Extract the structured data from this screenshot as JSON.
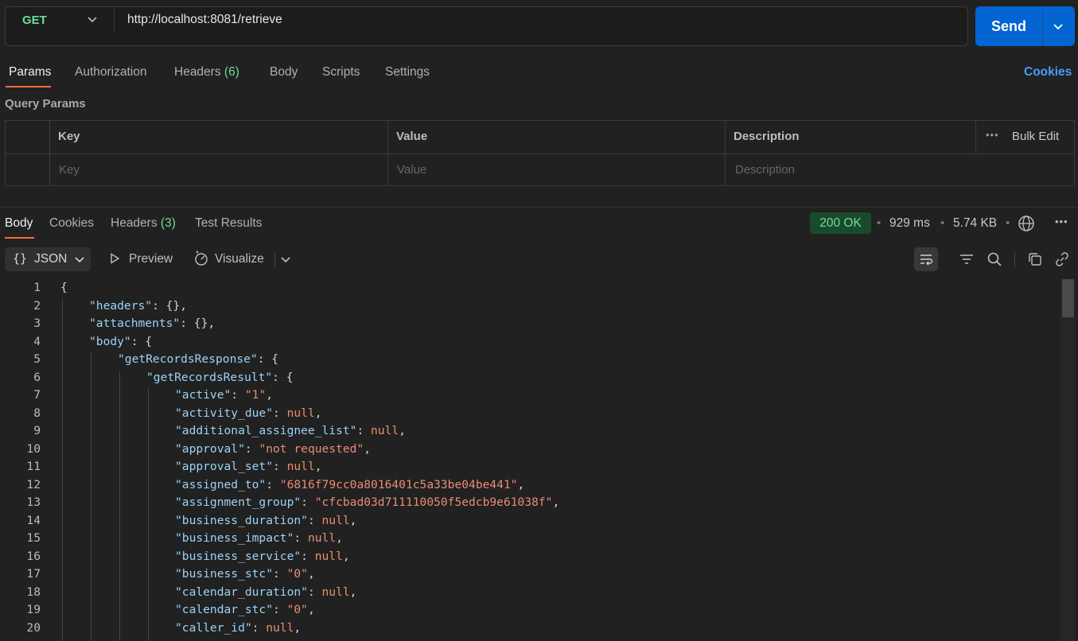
{
  "request": {
    "method": "GET",
    "url": "http://localhost:8081/retrieve",
    "send_label": "Send"
  },
  "request_tabs": {
    "params": "Params",
    "authorization": "Authorization",
    "headers": "Headers",
    "headers_count": "(6)",
    "body": "Body",
    "scripts": "Scripts",
    "settings": "Settings",
    "cookies": "Cookies"
  },
  "query_params": {
    "title": "Query Params",
    "columns": {
      "key": "Key",
      "value": "Value",
      "description": "Description",
      "bulk_edit": "Bulk Edit"
    },
    "placeholders": {
      "key": "Key",
      "value": "Value",
      "description": "Description"
    }
  },
  "response_tabs": {
    "body": "Body",
    "cookies": "Cookies",
    "headers": "Headers",
    "headers_count": "(3)",
    "test_results": "Test Results"
  },
  "response_meta": {
    "status": "200 OK",
    "time": "929 ms",
    "size": "5.74 KB",
    "status_color": "#6bdd9a"
  },
  "body_toolbar": {
    "format": "JSON",
    "preview": "Preview",
    "visualize": "Visualize"
  },
  "code_lines": [
    {
      "n": "1",
      "indent": 0,
      "tokens": [
        [
          "p",
          "{"
        ]
      ]
    },
    {
      "n": "2",
      "indent": 1,
      "tokens": [
        [
          "k",
          "\"headers\""
        ],
        [
          "p",
          ": {},"
        ]
      ]
    },
    {
      "n": "3",
      "indent": 1,
      "tokens": [
        [
          "k",
          "\"attachments\""
        ],
        [
          "p",
          ": {},"
        ]
      ]
    },
    {
      "n": "4",
      "indent": 1,
      "tokens": [
        [
          "k",
          "\"body\""
        ],
        [
          "p",
          ": {"
        ]
      ]
    },
    {
      "n": "5",
      "indent": 2,
      "tokens": [
        [
          "k",
          "\"getRecordsResponse\""
        ],
        [
          "p",
          ": {"
        ]
      ]
    },
    {
      "n": "6",
      "indent": 3,
      "tokens": [
        [
          "k",
          "\"getRecordsResult\""
        ],
        [
          "p",
          ": {"
        ]
      ]
    },
    {
      "n": "7",
      "indent": 4,
      "tokens": [
        [
          "k",
          "\"active\""
        ],
        [
          "p",
          ": "
        ],
        [
          "s",
          "\"1\""
        ],
        [
          "p",
          ","
        ]
      ]
    },
    {
      "n": "8",
      "indent": 4,
      "tokens": [
        [
          "k",
          "\"activity_due\""
        ],
        [
          "p",
          ": "
        ],
        [
          "n",
          "null"
        ],
        [
          "p",
          ","
        ]
      ]
    },
    {
      "n": "9",
      "indent": 4,
      "tokens": [
        [
          "k",
          "\"additional_assignee_list\""
        ],
        [
          "p",
          ": "
        ],
        [
          "n",
          "null"
        ],
        [
          "p",
          ","
        ]
      ]
    },
    {
      "n": "10",
      "indent": 4,
      "tokens": [
        [
          "k",
          "\"approval\""
        ],
        [
          "p",
          ": "
        ],
        [
          "s",
          "\"not requested\""
        ],
        [
          "p",
          ","
        ]
      ]
    },
    {
      "n": "11",
      "indent": 4,
      "tokens": [
        [
          "k",
          "\"approval_set\""
        ],
        [
          "p",
          ": "
        ],
        [
          "n",
          "null"
        ],
        [
          "p",
          ","
        ]
      ]
    },
    {
      "n": "12",
      "indent": 4,
      "tokens": [
        [
          "k",
          "\"assigned_to\""
        ],
        [
          "p",
          ": "
        ],
        [
          "s",
          "\"6816f79cc0a8016401c5a33be04be441\""
        ],
        [
          "p",
          ","
        ]
      ]
    },
    {
      "n": "13",
      "indent": 4,
      "tokens": [
        [
          "k",
          "\"assignment_group\""
        ],
        [
          "p",
          ": "
        ],
        [
          "s",
          "\"cfcbad03d711110050f5edcb9e61038f\""
        ],
        [
          "p",
          ","
        ]
      ]
    },
    {
      "n": "14",
      "indent": 4,
      "tokens": [
        [
          "k",
          "\"business_duration\""
        ],
        [
          "p",
          ": "
        ],
        [
          "n",
          "null"
        ],
        [
          "p",
          ","
        ]
      ]
    },
    {
      "n": "15",
      "indent": 4,
      "tokens": [
        [
          "k",
          "\"business_impact\""
        ],
        [
          "p",
          ": "
        ],
        [
          "n",
          "null"
        ],
        [
          "p",
          ","
        ]
      ]
    },
    {
      "n": "16",
      "indent": 4,
      "tokens": [
        [
          "k",
          "\"business_service\""
        ],
        [
          "p",
          ": "
        ],
        [
          "n",
          "null"
        ],
        [
          "p",
          ","
        ]
      ]
    },
    {
      "n": "17",
      "indent": 4,
      "tokens": [
        [
          "k",
          "\"business_stc\""
        ],
        [
          "p",
          ": "
        ],
        [
          "s",
          "\"0\""
        ],
        [
          "p",
          ","
        ]
      ]
    },
    {
      "n": "18",
      "indent": 4,
      "tokens": [
        [
          "k",
          "\"calendar_duration\""
        ],
        [
          "p",
          ": "
        ],
        [
          "n",
          "null"
        ],
        [
          "p",
          ","
        ]
      ]
    },
    {
      "n": "19",
      "indent": 4,
      "tokens": [
        [
          "k",
          "\"calendar_stc\""
        ],
        [
          "p",
          ": "
        ],
        [
          "s",
          "\"0\""
        ],
        [
          "p",
          ","
        ]
      ]
    },
    {
      "n": "20",
      "indent": 4,
      "tokens": [
        [
          "k",
          "\"caller_id\""
        ],
        [
          "p",
          ": "
        ],
        [
          "n",
          "null"
        ],
        [
          "p",
          ","
        ]
      ]
    }
  ]
}
